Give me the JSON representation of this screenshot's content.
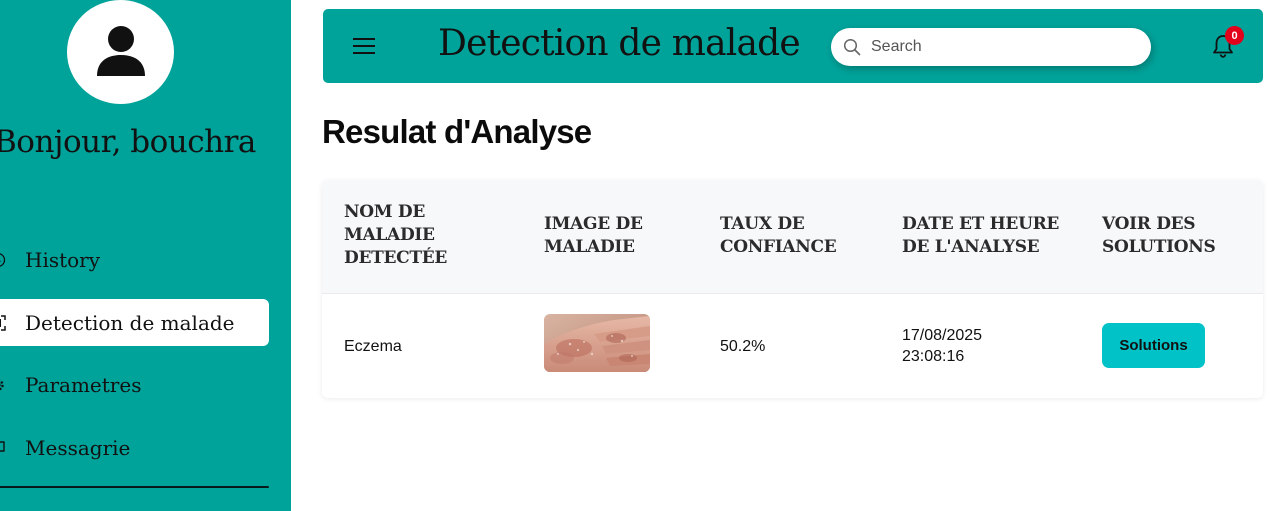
{
  "app": {
    "title": "Detection de malade"
  },
  "sidebar": {
    "greeting": "Bonjour, bouchra",
    "items": [
      {
        "label": "History",
        "icon": "history-icon",
        "active": false
      },
      {
        "label": "Detection de malade",
        "icon": "scan-icon",
        "active": true
      },
      {
        "label": "Parametres",
        "icon": "gear-icon",
        "active": false
      },
      {
        "label": "Messagrie",
        "icon": "message-icon",
        "active": false
      }
    ]
  },
  "header": {
    "menu_icon": "hamburger-icon",
    "search": {
      "placeholder": "Search",
      "value": ""
    },
    "notifications": {
      "icon": "bell-icon",
      "count": "0"
    }
  },
  "main": {
    "heading": "Resulat d'Analyse",
    "table": {
      "columns": [
        "NOM DE MALADIE DETECTÉE",
        "IMAGE DE MALADIE",
        "TAUX DE CONFIANCE",
        "DATE ET HEURE DE L'ANALYSE",
        "VOIR DES SOLUTIONS"
      ],
      "rows": [
        {
          "disease": "Eczema",
          "image": "eczema-skin-photo",
          "confidence": "50.2%",
          "date": "17/08/2025",
          "time": "23:08:16",
          "action": "Solutions"
        }
      ]
    }
  },
  "colors": {
    "accent": "#00a39a",
    "button": "#00c2c7",
    "badge": "#e3001b"
  }
}
